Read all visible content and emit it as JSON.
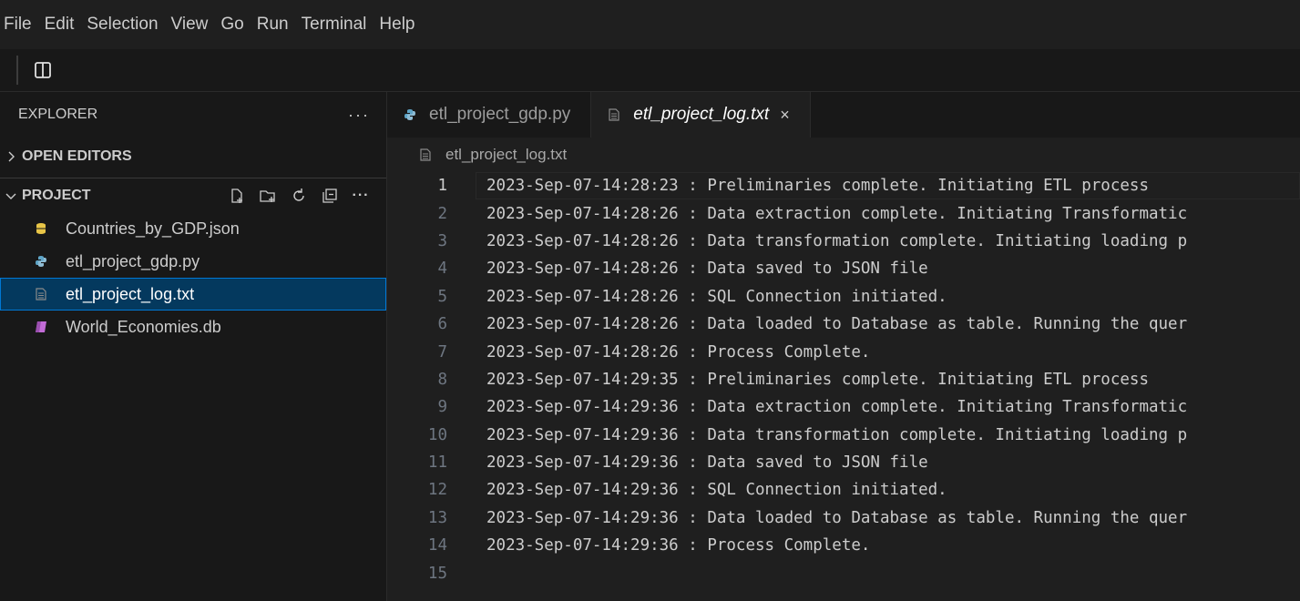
{
  "menu": [
    "File",
    "Edit",
    "Selection",
    "View",
    "Go",
    "Run",
    "Terminal",
    "Help"
  ],
  "sidebar": {
    "title": "EXPLORER",
    "more": "···",
    "open_editors": "OPEN EDITORS",
    "project": "PROJECT",
    "files": [
      {
        "name": "Countries_by_GDP.json",
        "icon": "json-file-icon",
        "color": "#e8c547"
      },
      {
        "name": "etl_project_gdp.py",
        "icon": "python-file-icon",
        "color": "#5fa5c7"
      },
      {
        "name": "etl_project_log.txt",
        "icon": "text-file-icon",
        "color": "#8a8a8a"
      },
      {
        "name": "World_Economies.db",
        "icon": "database-file-icon",
        "color": "#c26bd6"
      }
    ]
  },
  "tabs": [
    {
      "label": "etl_project_gdp.py",
      "icon": "python-file-icon"
    },
    {
      "label": "etl_project_log.txt",
      "icon": "text-file-icon",
      "close": "×"
    }
  ],
  "breadcrumb": "etl_project_log.txt",
  "editor": {
    "lines": [
      {
        "n": "1",
        "text": "2023-Sep-07-14:28:23 : Preliminaries complete. Initiating ETL process"
      },
      {
        "n": "2",
        "text": "2023-Sep-07-14:28:26 : Data extraction complete. Initiating Transformatic"
      },
      {
        "n": "3",
        "text": "2023-Sep-07-14:28:26 : Data transformation complete. Initiating loading p"
      },
      {
        "n": "4",
        "text": "2023-Sep-07-14:28:26 : Data saved to JSON file"
      },
      {
        "n": "5",
        "text": "2023-Sep-07-14:28:26 : SQL Connection initiated."
      },
      {
        "n": "6",
        "text": "2023-Sep-07-14:28:26 : Data loaded to Database as table. Running the quer"
      },
      {
        "n": "7",
        "text": "2023-Sep-07-14:28:26 : Process Complete."
      },
      {
        "n": "8",
        "text": "2023-Sep-07-14:29:35 : Preliminaries complete. Initiating ETL process"
      },
      {
        "n": "9",
        "text": "2023-Sep-07-14:29:36 : Data extraction complete. Initiating Transformatic"
      },
      {
        "n": "10",
        "text": "2023-Sep-07-14:29:36 : Data transformation complete. Initiating loading p"
      },
      {
        "n": "11",
        "text": "2023-Sep-07-14:29:36 : Data saved to JSON file"
      },
      {
        "n": "12",
        "text": "2023-Sep-07-14:29:36 : SQL Connection initiated."
      },
      {
        "n": "13",
        "text": "2023-Sep-07-14:29:36 : Data loaded to Database as table. Running the quer"
      },
      {
        "n": "14",
        "text": "2023-Sep-07-14:29:36 : Process Complete."
      },
      {
        "n": "15",
        "text": ""
      }
    ]
  }
}
